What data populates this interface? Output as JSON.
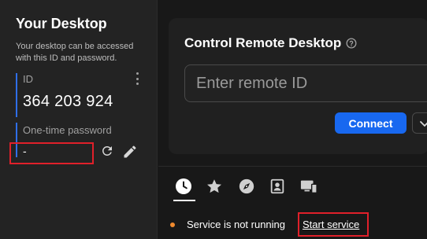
{
  "your_desktop": {
    "title": "Your Desktop",
    "description": "Your desktop can be accessed with this ID and password.",
    "id_label": "ID",
    "id_value": "364 203 924",
    "password_label": "One-time password",
    "password_value": "-"
  },
  "control": {
    "title": "Control Remote Desktop",
    "input_placeholder": "Enter remote ID",
    "input_value": "",
    "connect_label": "Connect"
  },
  "tabs": [
    {
      "name": "recent",
      "icon": "clock-icon",
      "active": true
    },
    {
      "name": "favorites",
      "icon": "star-icon",
      "active": false
    },
    {
      "name": "discovered",
      "icon": "compass-icon",
      "active": false
    },
    {
      "name": "address-book",
      "icon": "contact-card-icon",
      "active": false
    },
    {
      "name": "accessible-devices",
      "icon": "devices-icon",
      "active": false
    }
  ],
  "status": {
    "text": "Service is not running",
    "start_label": "Start service",
    "dot_color": "#f08a2e"
  },
  "colors": {
    "accent": "#1868f0",
    "highlight_box": "#e0202a"
  }
}
